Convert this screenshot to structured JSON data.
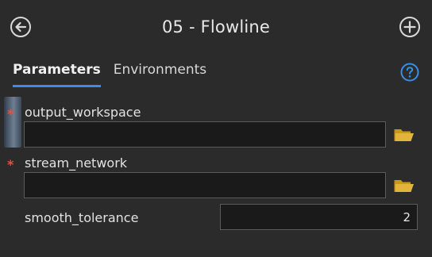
{
  "header": {
    "title": "05 - Flowline",
    "back_icon": "back-arrow-circle-icon",
    "add_icon": "plus-circle-icon"
  },
  "tabs": [
    {
      "label": "Parameters",
      "active": true
    },
    {
      "label": "Environments",
      "active": false
    }
  ],
  "help_icon": "help-question-icon",
  "parameters": [
    {
      "label": "output_workspace",
      "required": true,
      "value": "",
      "browse_icon": "folder-open-icon"
    },
    {
      "label": "stream_network",
      "required": true,
      "value": "",
      "browse_icon": "folder-open-icon"
    },
    {
      "label": "smooth_tolerance",
      "required": false,
      "value": "2"
    }
  ],
  "required_marker": "*",
  "colors": {
    "background": "#2b2b2b",
    "tab_underline": "#3a8ee6",
    "help_icon": "#3a8ee6",
    "required": "#e0563d",
    "folder": "#e2b43a"
  }
}
